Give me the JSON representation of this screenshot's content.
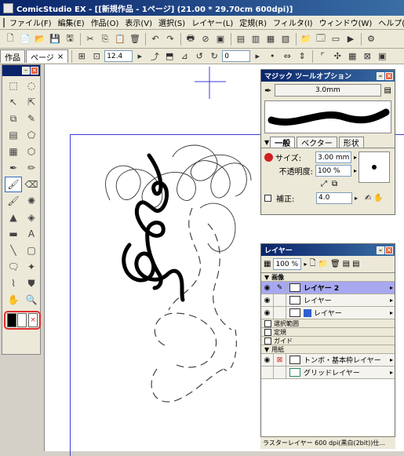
{
  "window": {
    "title": "ComicStudio EX - [[新規作品 - 1ページ] (21.00 * 29.70cm 600dpi)]"
  },
  "menu": [
    "ファイル(F)",
    "編集(E)",
    "作品(O)",
    "表示(V)",
    "選択(S)",
    "レイヤー(L)",
    "定規(R)",
    "フィルタ(I)",
    "ウィンドウ(W)",
    "ヘルプ(H)"
  ],
  "tabs": {
    "work": "作品",
    "page": "ページ",
    "page_close": "×"
  },
  "toolbar2": {
    "zoom_value": "12.4",
    "angle_value": "0"
  },
  "magic_panel": {
    "title": "マジック ツールオプション",
    "brush_size_display": "3.0mm",
    "tabs": [
      "一般",
      "ベクター",
      "形状"
    ],
    "size_label": "サイズ:",
    "size_value": "3.00 mm",
    "opacity_label": "不透明度:",
    "opacity_value": "100 %",
    "correction_label": "補正:",
    "correction_value": "4.0"
  },
  "layer_panel": {
    "title": "レイヤー",
    "opacity_value": "100 %",
    "group_image": "画像",
    "layers": [
      {
        "name": "レイヤー 2",
        "selected": true
      },
      {
        "name": "レイヤー",
        "selected": false
      },
      {
        "name": "レイヤー",
        "selected": false
      }
    ],
    "groups": [
      "選択範囲",
      "定規",
      "ガイド"
    ],
    "group_paper": "用紙",
    "paper_layers": [
      "トンボ・基本枠レイヤー",
      "グリッドレイヤー"
    ],
    "status": "ラスターレイヤー 600 dpi(黒白(2bit))仕..."
  },
  "colors": {
    "accent": "#0a246a",
    "selection": "#a8a8f0",
    "highlight": "#e03030"
  }
}
